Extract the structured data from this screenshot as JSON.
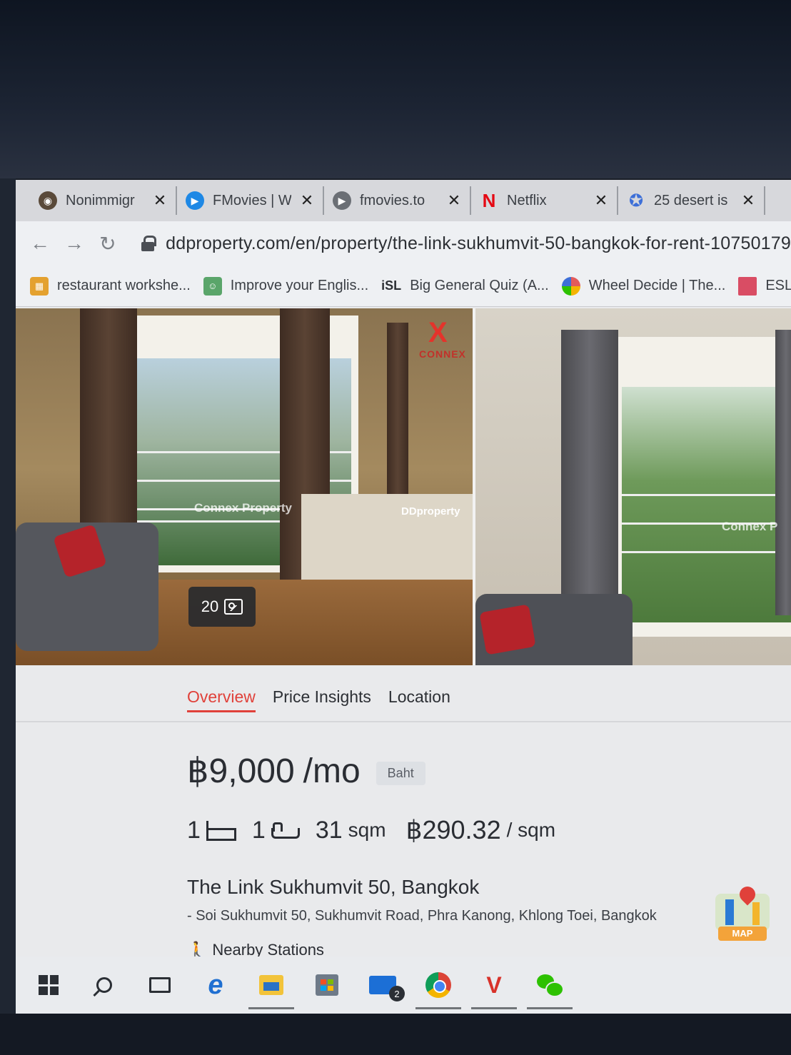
{
  "browser": {
    "tabs": [
      {
        "title": "Nonimmigr",
        "favicon": "seal-icon",
        "color": "#5a4a3a"
      },
      {
        "title": "FMovies | W",
        "favicon": "play-icon",
        "color": "#1e88e5"
      },
      {
        "title": "fmovies.to",
        "favicon": "play-icon",
        "color": "#6b6f75"
      },
      {
        "title": "Netflix",
        "favicon": "netflix-icon",
        "color": "#e50914"
      },
      {
        "title": "25 desert is",
        "favicon": "star-icon",
        "color": "#3d6fd8"
      }
    ],
    "url": "ddproperty.com/en/property/the-link-sukhumvit-50-bangkok-for-rent-10750179",
    "bookmarks": [
      {
        "label": "restaurant workshe...",
        "icon": "grid-icon",
        "color": "#e4a12f"
      },
      {
        "label": "Improve your Englis...",
        "icon": "people-icon",
        "color": "#5aa56a"
      },
      {
        "label": "Big General Quiz (A...",
        "icon": "isl-icon",
        "color": "#2c2f34",
        "prefix": "iSL"
      },
      {
        "label": "Wheel Decide | The...",
        "icon": "wheel-icon",
        "color": "#e35b5b"
      },
      {
        "label": "ESLj",
        "icon": "flag-icon",
        "color": "#d94d64"
      }
    ]
  },
  "gallery": {
    "photo_count": "20",
    "watermark_1": "Connex Property",
    "watermark_2": "DDproperty",
    "watermark_3": "Connex P",
    "logo_letter": "X",
    "logo_text": "CONNEX"
  },
  "tabs": {
    "overview": "Overview",
    "price_insights": "Price Insights",
    "location": "Location"
  },
  "listing": {
    "price": "฿9,000",
    "price_unit": "/mo",
    "currency": "Baht",
    "bedrooms": "1",
    "bathrooms": "1",
    "size_value": "31",
    "size_unit": "sqm",
    "price_per_sqm": "฿290.32",
    "price_per_sqm_unit": "/ sqm",
    "title": "The Link Sukhumvit 50, Bangkok",
    "address": "- Soi Sukhumvit 50, Sukhumvit Road, Phra Kanong, Khlong Toei, Bangkok",
    "nearby_label": "Nearby Stations",
    "map_label": "MAP"
  },
  "taskbar": {
    "mail_badge": "2"
  }
}
